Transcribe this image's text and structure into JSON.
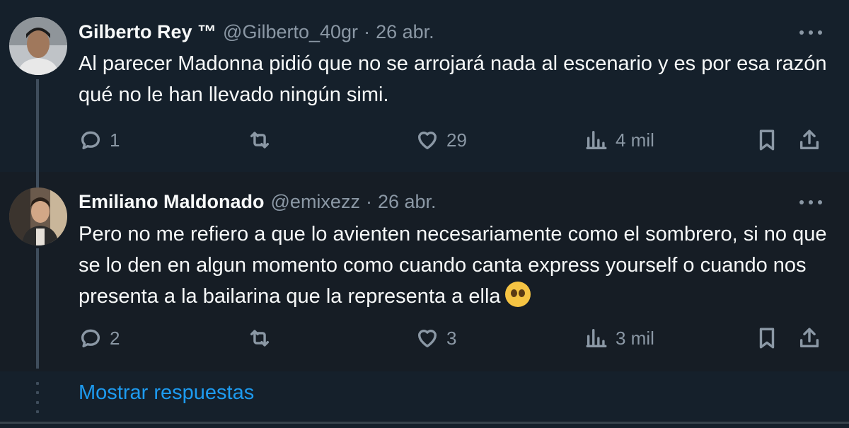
{
  "tweets": [
    {
      "name": "Gilberto Rey ™",
      "handle": "@Gilberto_40gr",
      "separator": "·",
      "time": "26 abr.",
      "text": "Al parecer Madonna pidió que no se arrojará nada al escenario y es por esa razón qué no le han llevado ningún simi.",
      "replies": "1",
      "retweets": "",
      "likes": "29",
      "views": "4 mil"
    },
    {
      "name": "Emiliano Maldonado",
      "handle": "@emixezz",
      "separator": "·",
      "time": "26 abr.",
      "text": "Pero no me refiero a que lo avienten necesariamente como el sombrero, si no que se lo den en algun momento como cuando canta express yourself o cuando nos presenta a la bailarina que la representa a ella",
      "emoji": "pleading-face",
      "replies": "2",
      "retweets": "",
      "likes": "3",
      "views": "3 mil"
    }
  ],
  "show_replies_label": "Mostrar respuestas",
  "colors": {
    "background": "#15202b",
    "secondary_text": "#8b98a5",
    "link": "#1d9bf0"
  },
  "icons": [
    "reply-icon",
    "retweet-icon",
    "like-icon",
    "views-icon",
    "bookmark-icon",
    "share-icon",
    "more-icon"
  ]
}
